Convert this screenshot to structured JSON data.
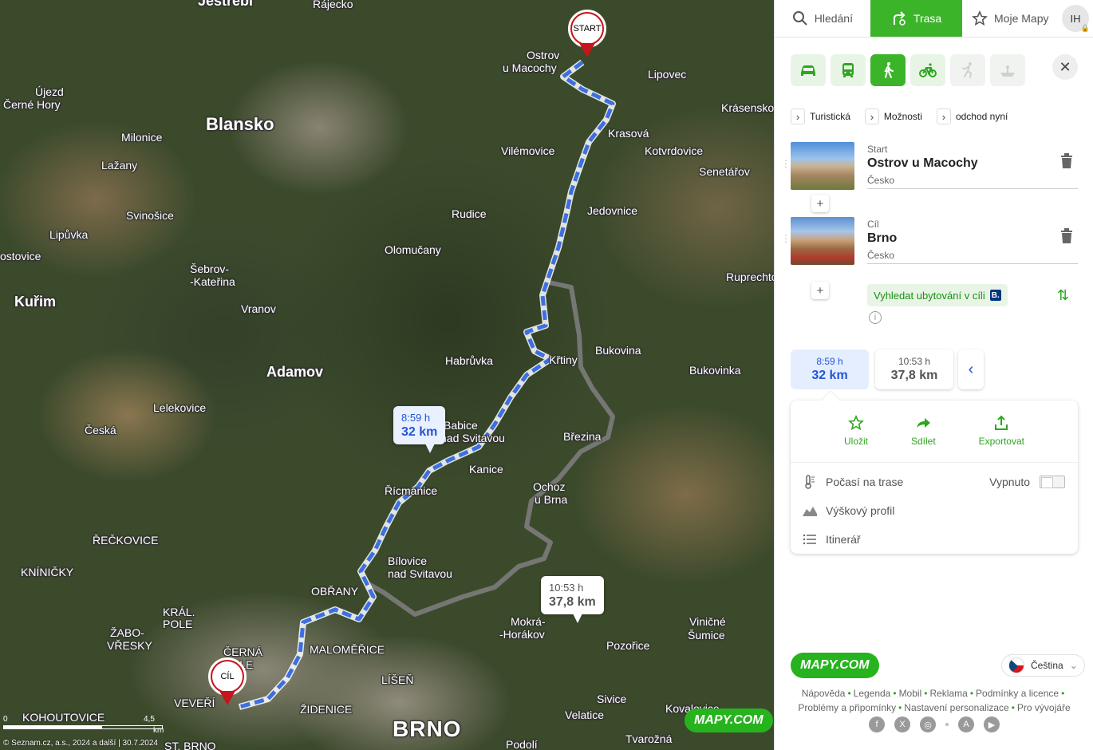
{
  "map": {
    "places": [
      {
        "name": "Jestřebí",
        "cls": "mid"
      },
      {
        "name": "Rájecko",
        "cls": ""
      },
      {
        "name": "Ostrov",
        "cls": ""
      },
      {
        "name": "u Macochy",
        "cls": ""
      },
      {
        "name": "Lipovec",
        "cls": ""
      },
      {
        "name": "Újezd",
        "cls": ""
      },
      {
        "name": "Černé Hory",
        "cls": ""
      },
      {
        "name": "Blansko",
        "cls": "big"
      },
      {
        "name": "Krásensko",
        "cls": ""
      },
      {
        "name": "Milonice",
        "cls": ""
      },
      {
        "name": "Krasová",
        "cls": ""
      },
      {
        "name": "Vilémovice",
        "cls": ""
      },
      {
        "name": "Kotvrdovice",
        "cls": ""
      },
      {
        "name": "Lažany",
        "cls": ""
      },
      {
        "name": "Senetářov",
        "cls": ""
      },
      {
        "name": "Jedovnice",
        "cls": ""
      },
      {
        "name": "Svinošice",
        "cls": ""
      },
      {
        "name": "Rudice",
        "cls": ""
      },
      {
        "name": "Lipůvka",
        "cls": ""
      },
      {
        "name": "Olomučany",
        "cls": ""
      },
      {
        "name": "ostovice",
        "cls": ""
      },
      {
        "name": "Šebrov-",
        "cls": ""
      },
      {
        "name": "-Kateřina",
        "cls": ""
      },
      {
        "name": "Ruprechtov",
        "cls": ""
      },
      {
        "name": "Kuřim",
        "cls": "mid"
      },
      {
        "name": "Vranov",
        "cls": ""
      },
      {
        "name": "Bukovina",
        "cls": ""
      },
      {
        "name": "Habrůvka",
        "cls": ""
      },
      {
        "name": "Křtiny",
        "cls": ""
      },
      {
        "name": "Adamov",
        "cls": "mid"
      },
      {
        "name": "Bukovinka",
        "cls": ""
      },
      {
        "name": "Lelekovice",
        "cls": ""
      },
      {
        "name": "Babice",
        "cls": ""
      },
      {
        "name": "nad Svitavou",
        "cls": ""
      },
      {
        "name": "Česká",
        "cls": ""
      },
      {
        "name": "Březina",
        "cls": ""
      },
      {
        "name": "Kanice",
        "cls": ""
      },
      {
        "name": "Řícmanice",
        "cls": ""
      },
      {
        "name": "Ochoz",
        "cls": ""
      },
      {
        "name": "u Brna",
        "cls": ""
      },
      {
        "name": "ŘEČKOVICE",
        "cls": ""
      },
      {
        "name": "Bílovice",
        "cls": ""
      },
      {
        "name": "nad Svitavou",
        "cls": ""
      },
      {
        "name": "KNÍNIČKY",
        "cls": ""
      },
      {
        "name": "OBŘANY",
        "cls": ""
      },
      {
        "name": "KRÁL.",
        "cls": ""
      },
      {
        "name": "POLE",
        "cls": ""
      },
      {
        "name": "Mokrá-",
        "cls": ""
      },
      {
        "name": "-Horákov",
        "cls": ""
      },
      {
        "name": "Viničné",
        "cls": ""
      },
      {
        "name": "Šumice",
        "cls": ""
      },
      {
        "name": "ŽABO-",
        "cls": ""
      },
      {
        "name": "VŘESKY",
        "cls": ""
      },
      {
        "name": "MALOMĚŘICE",
        "cls": ""
      },
      {
        "name": "Pozořice",
        "cls": ""
      },
      {
        "name": "LÍŠEŇ",
        "cls": ""
      },
      {
        "name": "VEVEŘÍ",
        "cls": ""
      },
      {
        "name": "ŽIDENICE",
        "cls": ""
      },
      {
        "name": "Sivice",
        "cls": ""
      },
      {
        "name": "KOHOUTOVICE",
        "cls": ""
      },
      {
        "name": "Velatice",
        "cls": ""
      },
      {
        "name": "Kovalovice",
        "cls": ""
      },
      {
        "name": "BRNO",
        "cls": "huge"
      },
      {
        "name": "Tvarožná",
        "cls": ""
      },
      {
        "name": "Podolí",
        "cls": ""
      },
      {
        "name": "ST. BRNO",
        "cls": ""
      },
      {
        "name": "ČERNÁ",
        "cls": ""
      },
      {
        "name": "POLE",
        "cls": ""
      }
    ],
    "start_label": "START",
    "end_label": "CÍL",
    "route_main": {
      "time": "8:59 h",
      "distance": "32 km"
    },
    "route_alt": {
      "time": "10:53 h",
      "distance": "37,8 km"
    },
    "scale": {
      "zero": "0",
      "value": "4,5",
      "unit": "km"
    },
    "copyright": "© Seznam.cz, a.s., 2024 a další | 30.7.2024",
    "logo": "MAPY.COM"
  },
  "panel": {
    "tabs": [
      {
        "label": "Hledání",
        "icon": "search-icon"
      },
      {
        "label": "Trasa",
        "icon": "route-icon"
      },
      {
        "label": "Moje Mapy",
        "icon": "star-icon"
      }
    ],
    "avatar": "IH",
    "modes": [
      "car-icon",
      "bus-icon",
      "walk-icon",
      "bike-icon",
      "run-icon",
      "boat-icon"
    ],
    "options": [
      "Turistická",
      "Možnosti",
      "odchod nyní"
    ],
    "stops": [
      {
        "label": "Start",
        "name": "Ostrov u Macochy",
        "country": "Česko"
      },
      {
        "label": "Cíl",
        "name": "Brno",
        "country": "Česko"
      }
    ],
    "hotel_label": "Vyhledat ubytování v cíli",
    "hotel_badge": "B.",
    "variants": [
      {
        "time": "8:59 h",
        "distance": "32 km"
      },
      {
        "time": "10:53 h",
        "distance": "37,8 km"
      }
    ],
    "actions": [
      {
        "label": "Uložit",
        "icon": "star-outline-icon"
      },
      {
        "label": "Sdílet",
        "icon": "share-arrow-icon"
      },
      {
        "label": "Exportovat",
        "icon": "export-icon"
      }
    ],
    "rows": [
      {
        "label": "Počasí na trase",
        "icon": "thermometer-icon",
        "right": "Vypnuto"
      },
      {
        "label": "Výškový profil",
        "icon": "elevation-icon"
      },
      {
        "label": "Itinerář",
        "icon": "list-icon"
      }
    ],
    "brand": "MAPY.COM",
    "language": "Čeština",
    "footer_links": [
      "Nápověda",
      "Legenda",
      "Mobil",
      "Reklama",
      "Podmínky a licence",
      "Problémy a připomínky",
      "Nastavení personalizace",
      "Pro vývojáře"
    ],
    "socials": [
      "facebook-icon",
      "x-icon",
      "instagram-icon",
      "appstore-icon",
      "googleplay-icon"
    ]
  },
  "colors": {
    "accent": "#3cb42a",
    "route_main": "#3d6fe0",
    "route_alt": "#808080",
    "pin": "#c4161c"
  }
}
